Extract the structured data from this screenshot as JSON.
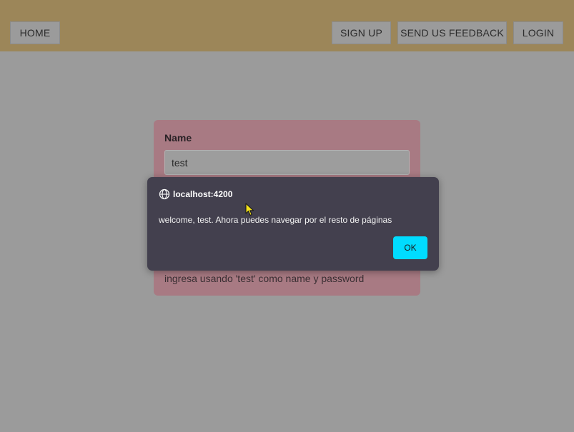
{
  "nav": {
    "home": "HOME",
    "sign_up": "SIGN UP",
    "feedback": "SEND US FEEDBACK",
    "login": "LOGIN"
  },
  "form": {
    "name_label": "Name",
    "name_value": "test",
    "hint": "ingresa usando 'test' como name y password"
  },
  "dialog": {
    "origin": "localhost:4200",
    "origin_icon": "globe-icon",
    "message": "welcome, test. Ahora puedes navegar por el resto de páginas",
    "ok_label": "OK"
  },
  "colors": {
    "topbar": "#9c8659",
    "card": "#a87a83",
    "dialog": "#43404e",
    "ok_button": "#00dcff"
  }
}
